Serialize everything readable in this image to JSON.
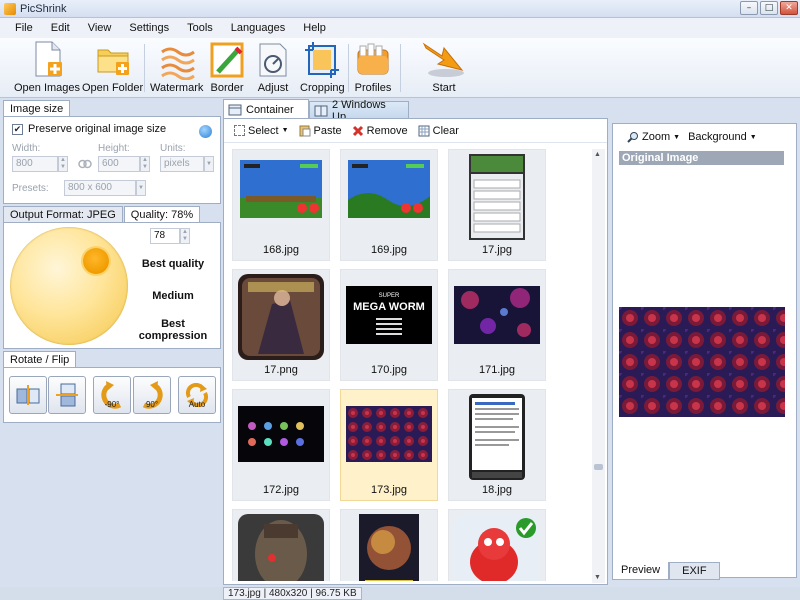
{
  "window": {
    "title": "PicShrink",
    "controls": {
      "minimize": "–",
      "maximize": "□",
      "close": "✕"
    }
  },
  "menu": [
    "File",
    "Edit",
    "View",
    "Settings",
    "Tools",
    "Languages",
    "Help"
  ],
  "toolbar": {
    "open_images": "Open Images",
    "open_folder": "Open Folder",
    "watermark": "Watermark",
    "border": "Border",
    "adjust": "Adjust",
    "cropping": "Cropping",
    "profiles": "Profiles",
    "start": "Start"
  },
  "image_size": {
    "tab": "Image size",
    "preserve": "Preserve original image size",
    "preserve_checked": true,
    "width_label": "Width:",
    "width_value": "800",
    "height_label": "Height:",
    "height_value": "600",
    "units_label": "Units:",
    "units_value": "pixels",
    "presets_label": "Presets:",
    "presets_value": "800 x 600"
  },
  "output": {
    "format_tab": "Output Format: JPEG",
    "quality_tab": "Quality: 78%",
    "quality_value": "78",
    "quality_fraction": 0.78,
    "best_quality": "Best quality",
    "medium": "Medium",
    "best_compression": "Best compression"
  },
  "rotate": {
    "tab": "Rotate / Flip",
    "minus90": "-90°",
    "plus90": "90°",
    "auto": "Auto"
  },
  "center": {
    "tab_container": "Container",
    "tab_2windows": "2 Windows Up",
    "select": "Select",
    "paste": "Paste",
    "remove": "Remove",
    "clear": "Clear",
    "thumbnails": [
      {
        "name": "168.jpg",
        "kind": "game-green"
      },
      {
        "name": "169.jpg",
        "kind": "game-green"
      },
      {
        "name": "17.jpg",
        "kind": "phone-menu"
      },
      {
        "name": "17.png",
        "kind": "poster"
      },
      {
        "name": "170.jpg",
        "kind": "mega-worm"
      },
      {
        "name": "171.jpg",
        "kind": "space-bubbles"
      },
      {
        "name": "172.jpg",
        "kind": "dark-icons"
      },
      {
        "name": "173.jpg",
        "kind": "red-pattern",
        "selected": true
      },
      {
        "name": "18.jpg",
        "kind": "phone-text"
      },
      {
        "name": "",
        "kind": "predator"
      },
      {
        "name": "",
        "kind": "nebula-phone"
      },
      {
        "name": "",
        "kind": "red-blob"
      }
    ],
    "mega_worm": {
      "super": "SUPER",
      "title": "MEGA WORM"
    }
  },
  "preview": {
    "zoom": "Zoom",
    "background": "Background",
    "original_image": "Original Image",
    "tab_preview": "Preview",
    "tab_exif": "EXIF"
  },
  "status": {
    "text": "173.jpg | 480x320 | 96.75 KB"
  },
  "colors": {
    "accent": "#2f7fd4",
    "selection": "#fff1c9",
    "start_arrow": "#f39c12"
  }
}
